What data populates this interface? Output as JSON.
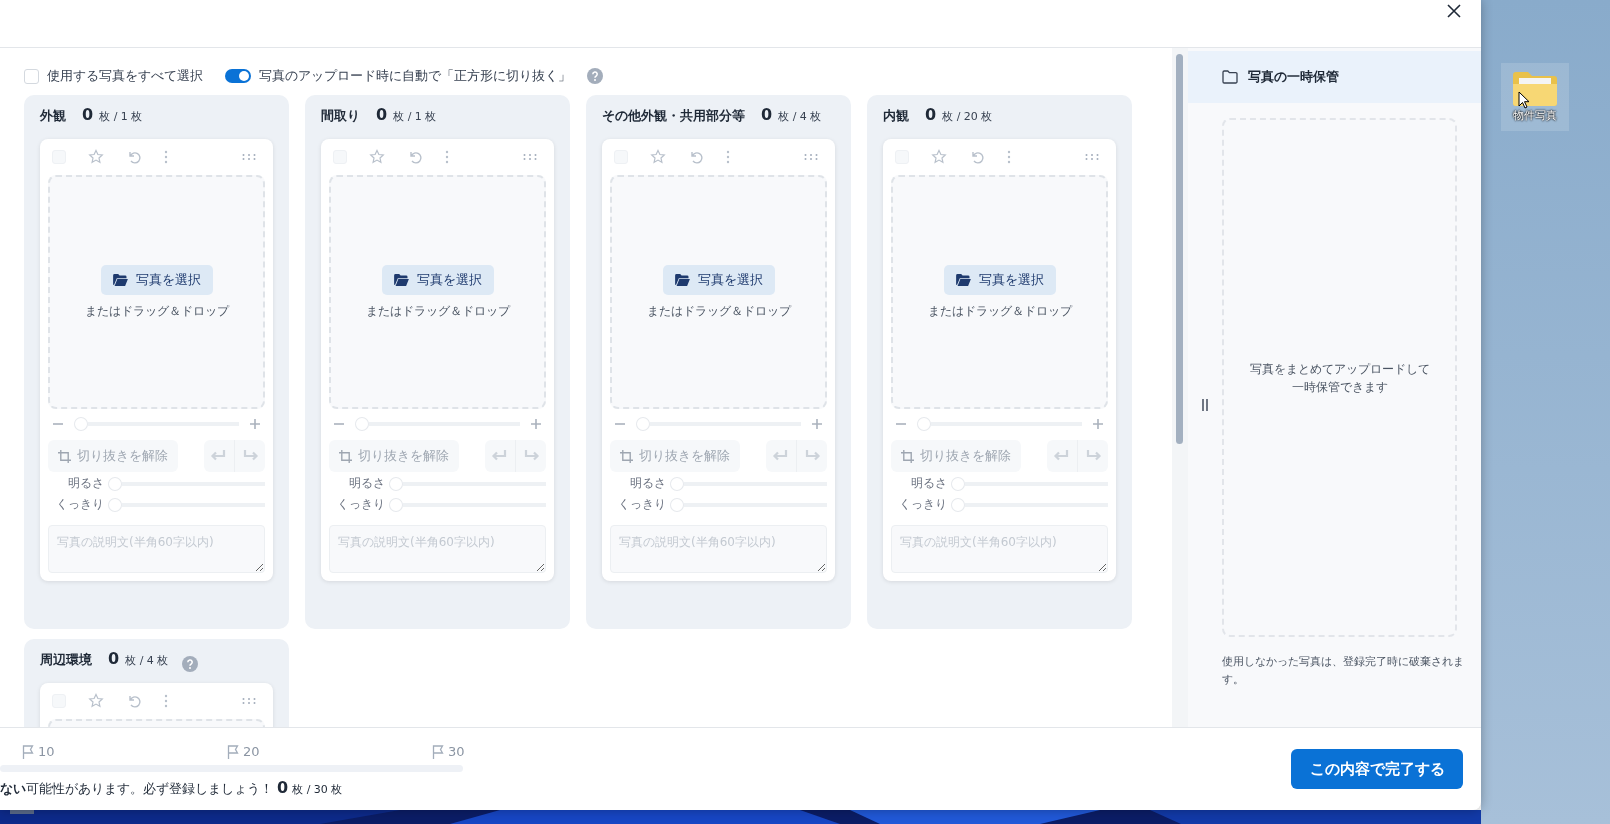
{
  "select_all": {
    "label": "使用する写真をすべて選択",
    "checked": false
  },
  "auto_crop": {
    "label": "写真のアップロード時に自動で「正方形に切り抜く」",
    "on": true
  },
  "categories": [
    {
      "name": "外観",
      "count": "0",
      "of": "枚 / 1 枚",
      "checked": false,
      "upload": {
        "button": "写真を選択",
        "hint": "またはドラッグ＆ドロップ"
      },
      "zoom_level": {
        "level": 0
      },
      "crop": {
        "label": "切り抜きを解除",
        "disabled": true
      },
      "sliders": [
        {
          "label": "明るさ",
          "level": 0
        },
        {
          "label": "くっきり",
          "level": 0
        }
      ],
      "placeholder": "写真の説明文(半角60字以内)"
    },
    {
      "name": "間取り",
      "count": "0",
      "of": "枚 / 1 枚",
      "checked": false,
      "upload": {
        "button": "写真を選択",
        "hint": "またはドラッグ＆ドロップ"
      },
      "zoom_level": {
        "level": 0
      },
      "crop": {
        "label": "切り抜きを解除",
        "disabled": true
      },
      "sliders": [
        {
          "label": "明るさ",
          "level": 0
        },
        {
          "label": "くっきり",
          "level": 0
        }
      ],
      "placeholder": "写真の説明文(半角60字以内)"
    },
    {
      "name": "その他外観・共用部分等",
      "count": "0",
      "of": "枚 / 4 枚",
      "checked": false,
      "upload": {
        "button": "写真を選択",
        "hint": "またはドラッグ＆ドロップ"
      },
      "zoom_level": {
        "level": 0
      },
      "crop": {
        "label": "切り抜きを解除",
        "disabled": true
      },
      "sliders": [
        {
          "label": "明るさ",
          "level": 0
        },
        {
          "label": "くっきり",
          "level": 0
        }
      ],
      "placeholder": "写真の説明文(半角60字以内)"
    },
    {
      "name": "内観",
      "count": "0",
      "of": "枚 / 20 枚",
      "checked": false,
      "upload": {
        "button": "写真を選択",
        "hint": "またはドラッグ＆ドロップ"
      },
      "zoom_level": {
        "level": 0
      },
      "crop": {
        "label": "切り抜きを解除",
        "disabled": true
      },
      "sliders": [
        {
          "label": "明るさ",
          "level": 0
        },
        {
          "label": "くっきり",
          "level": 0
        }
      ],
      "placeholder": "写真の説明文(半角60字以内)"
    },
    {
      "name": "周辺環境",
      "count": "0",
      "of": "枚 / 4 枚",
      "help": true,
      "checked": false
    }
  ],
  "temp_storage": {
    "title": "写真の一時保管",
    "drop_text": [
      "写真をまとめてアップロードして",
      "一時保管できます"
    ],
    "note": "使用しなかった写真は、登録完了時に破棄されます。"
  },
  "footer": {
    "milestones": [
      "10",
      "20",
      "30"
    ],
    "progress": {
      "level": 0
    },
    "message": "**ない**可能性があります。必ず登録しましょう！",
    "count": "0",
    "of": "枚 / 30 枚",
    "submit": "この内容で完了する"
  },
  "desktop": {
    "icon_label": "物件写真"
  }
}
